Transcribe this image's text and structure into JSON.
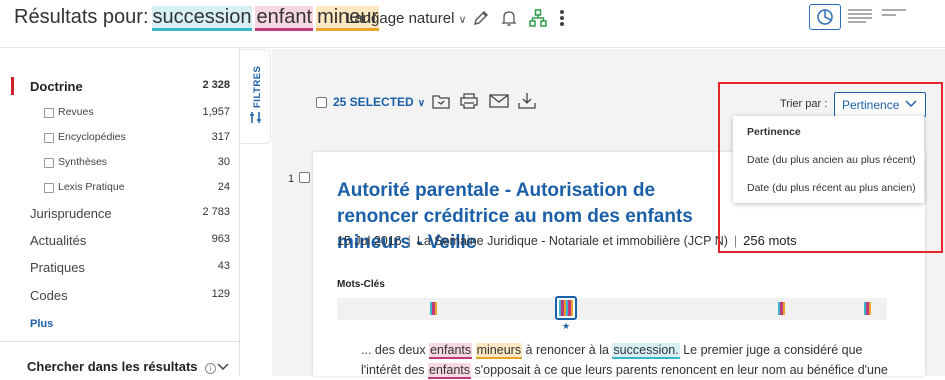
{
  "header": {
    "results_label": "Résultats pour:",
    "terms": [
      "succession",
      "enfant",
      "mineur"
    ],
    "language": "Langage naturel"
  },
  "sidebar": {
    "items": [
      {
        "label": "Doctrine",
        "count": "2 328"
      },
      {
        "label": "Revues",
        "count": "1,957"
      },
      {
        "label": "Encyclopédies",
        "count": "317"
      },
      {
        "label": "Synthèses",
        "count": "30"
      },
      {
        "label": "Lexis Pratique",
        "count": "24"
      },
      {
        "label": "Jurisprudence",
        "count": "2 783"
      },
      {
        "label": "Actualités",
        "count": "963"
      },
      {
        "label": "Pratiques",
        "count": "43"
      },
      {
        "label": "Codes",
        "count": "129"
      }
    ],
    "plus": "Plus",
    "search_within": "Chercher dans les résultats"
  },
  "filters_tab": "FILTRES",
  "toolbar": {
    "selected": "25 SELECTED"
  },
  "sort": {
    "label": "Trier par :",
    "selected": "Pertinence",
    "options": [
      "Pertinence",
      "Date (du plus ancien au plus récent)",
      "Date (du plus récent au plus ancien)"
    ]
  },
  "result": {
    "number": "1",
    "title": "Autorité parentale - Autorisation de renoncer créditrice au nom des enfants mineurs - Veille",
    "date": "15 Jul 2016",
    "source": "La Semaine Juridique - Notariale et immobilière (JCP N)",
    "words": "256 mots",
    "keywords_label": "Mots-Clés",
    "snippet": {
      "part1": "... des deux ",
      "hl1": "enfants",
      "hl2": "mineurs",
      "part2": " à renoncer à la ",
      "hl3": "succession.",
      "part3": " Le premier juge a considéré que",
      "part4": "l'intérêt des ",
      "hl4": "enfants",
      "part5": " s'opposait à ce que leurs parents renoncent en leur nom au bénéfice d'une"
    }
  },
  "colors": {
    "accent": "#1a5fa8",
    "term_succession": "#3ab4cc",
    "term_enfant": "#c0397a",
    "term_mineur": "#e9a52b",
    "highlight_box": "#e2242c"
  }
}
